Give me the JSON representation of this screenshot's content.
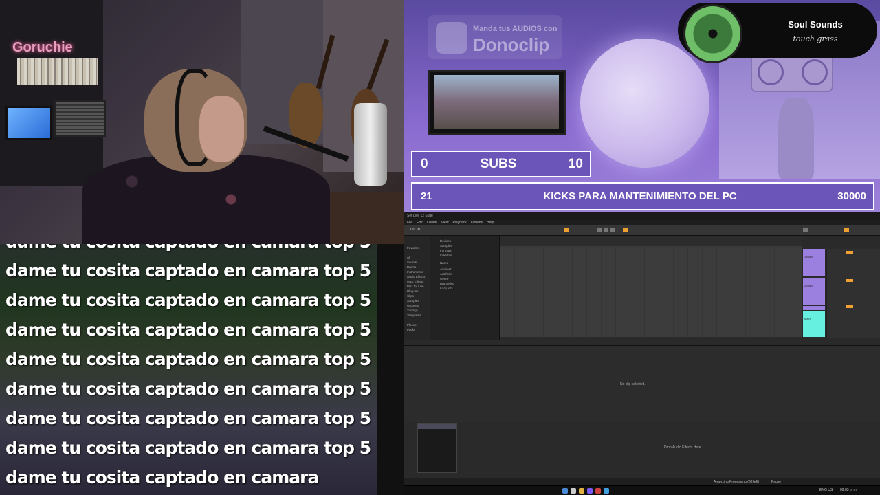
{
  "webcam": {
    "tag": "Goruchie"
  },
  "overlay": {
    "donoclip_small": "Manda tus AUDIOS con",
    "donoclip_big": "Donoclip",
    "music": {
      "song": "Soul Sounds",
      "artist": "touch grass"
    },
    "subs_goal": {
      "current": "0",
      "label": "SUBS",
      "target": "10"
    },
    "kicks_goal": {
      "current": "21",
      "label": "KICKS PARA MANTENIMIENTO DEL PC",
      "target": "30000"
    }
  },
  "chat": {
    "lines": [
      "dame tu cosita captado en camara top 5",
      "dame tu cosita captado en camara top 5",
      "dame tu cosita captado en camara top 5",
      "dame tu cosita captado en camara top 5",
      "dame tu cosita captado en camara top 5",
      "dame tu cosita captado en camara top 5",
      "dame tu cosita captado en camara top 5",
      "dame tu cosita captado en camara top 5",
      "dame tu cosita captado en camara"
    ]
  },
  "ableton": {
    "title": "Set Live 12 Suite",
    "menu": [
      "File",
      "Edit",
      "Create",
      "View",
      "Playback",
      "Options",
      "Help"
    ],
    "tempo": "120.00",
    "browser_side": [
      "Favorites",
      "All",
      "Sounds",
      "Drums",
      "Instruments",
      "Audio Effects",
      "MIDI Effects",
      "Max for Live",
      "Plug-Ins",
      "Clips",
      "Samples",
      "Grooves",
      "Tunings",
      "Templates",
      "Places",
      "Packs"
    ],
    "browser_list": [
      "Devices",
      "Samples",
      "Formats",
      "Creators",
      "Name",
      "Ambient",
      "Artefacts",
      "Genre",
      "Drum Kits",
      "Loop Kits"
    ],
    "tracks": [
      "1 MIDI",
      "2 MIDI",
      "3 Audio",
      "Main"
    ],
    "detail_hint": "No clip selected.",
    "device_drop": "Drop Audio Effects Here",
    "status": "Analyzing Processing (38 left)",
    "pause_label": "Pause",
    "time": "09:03 p. m.",
    "lang": "ENG US"
  }
}
